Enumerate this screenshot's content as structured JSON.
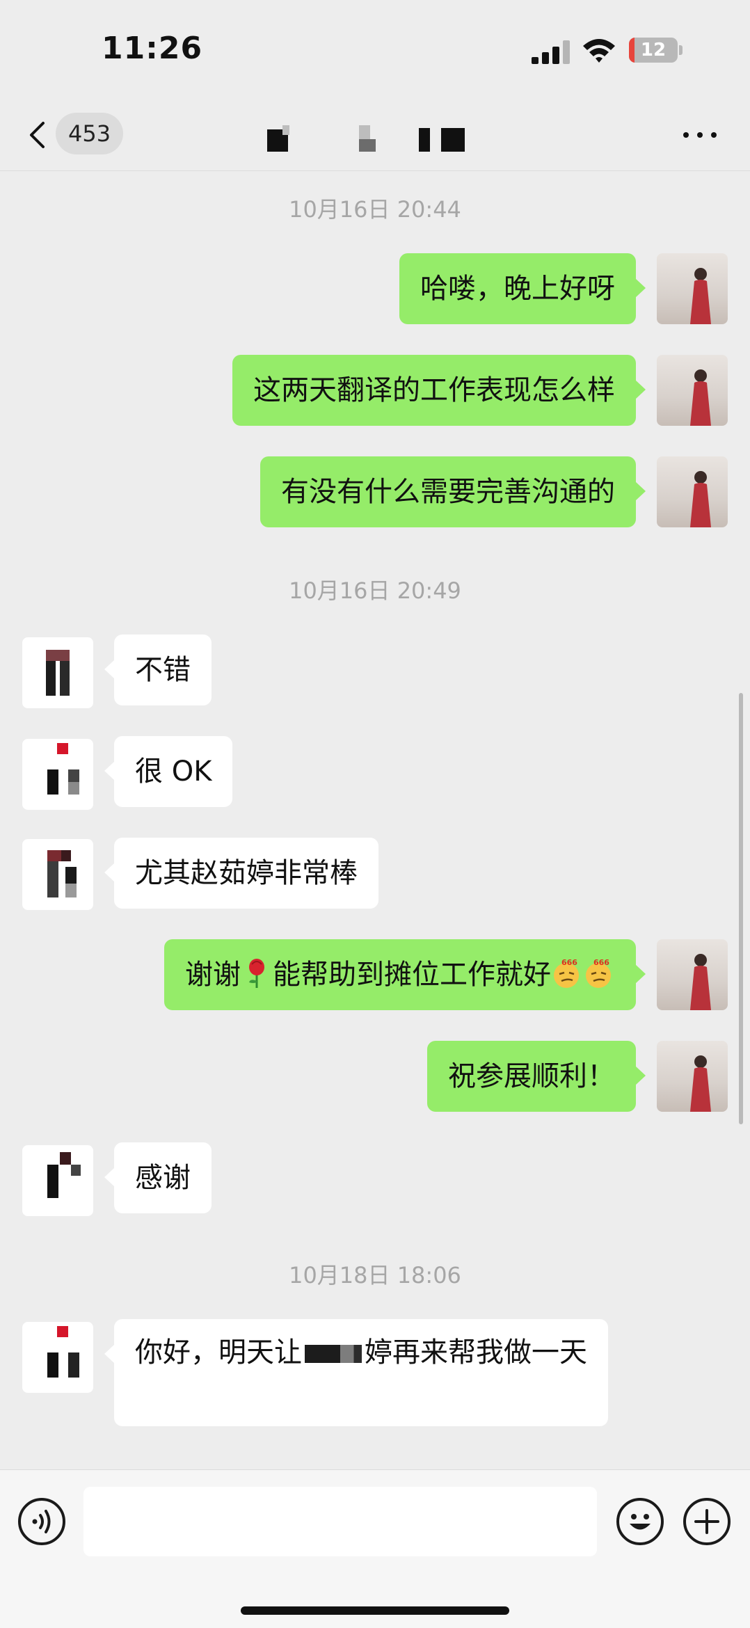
{
  "status_bar": {
    "time": "11:26",
    "battery_level": "12",
    "battery_color": "#e8453c"
  },
  "nav": {
    "unread_count": "453",
    "title_redacted": true
  },
  "messages": [
    {
      "kind": "timestamp",
      "text": "10月16日 20:44"
    },
    {
      "kind": "outgoing",
      "text": "哈喽，晚上好呀"
    },
    {
      "kind": "outgoing",
      "text": "这两天翻译的工作表现怎么样"
    },
    {
      "kind": "outgoing",
      "text": "有没有什么需要完善沟通的"
    },
    {
      "kind": "timestamp",
      "text": "10月16日 20:49"
    },
    {
      "kind": "incoming",
      "text": "不错"
    },
    {
      "kind": "incoming",
      "text": "很 OK"
    },
    {
      "kind": "incoming",
      "text": "尤其赵茹婷非常棒"
    },
    {
      "kind": "outgoing",
      "text_before": "谢谢",
      "icon_rose": "rose-emoji",
      "text_after": "能帮助到摊位工作就好",
      "emoji_badge": "666"
    },
    {
      "kind": "outgoing",
      "text": "祝参展顺利！"
    },
    {
      "kind": "incoming",
      "text": "感谢"
    },
    {
      "kind": "timestamp",
      "text": "10月18日 18:06"
    },
    {
      "kind": "incoming",
      "text_before": "你好，明天让",
      "text_after": "婷再来帮我做一天"
    }
  ],
  "colors": {
    "outgoing_bubble": "#95ec69",
    "incoming_bubble": "#ffffff",
    "background": "#ededed"
  },
  "icons": {
    "back": "chevron-left-icon",
    "more": "ellipsis-icon",
    "voice": "voice-icon",
    "emoji": "smiley-icon",
    "plus": "plus-icon"
  }
}
